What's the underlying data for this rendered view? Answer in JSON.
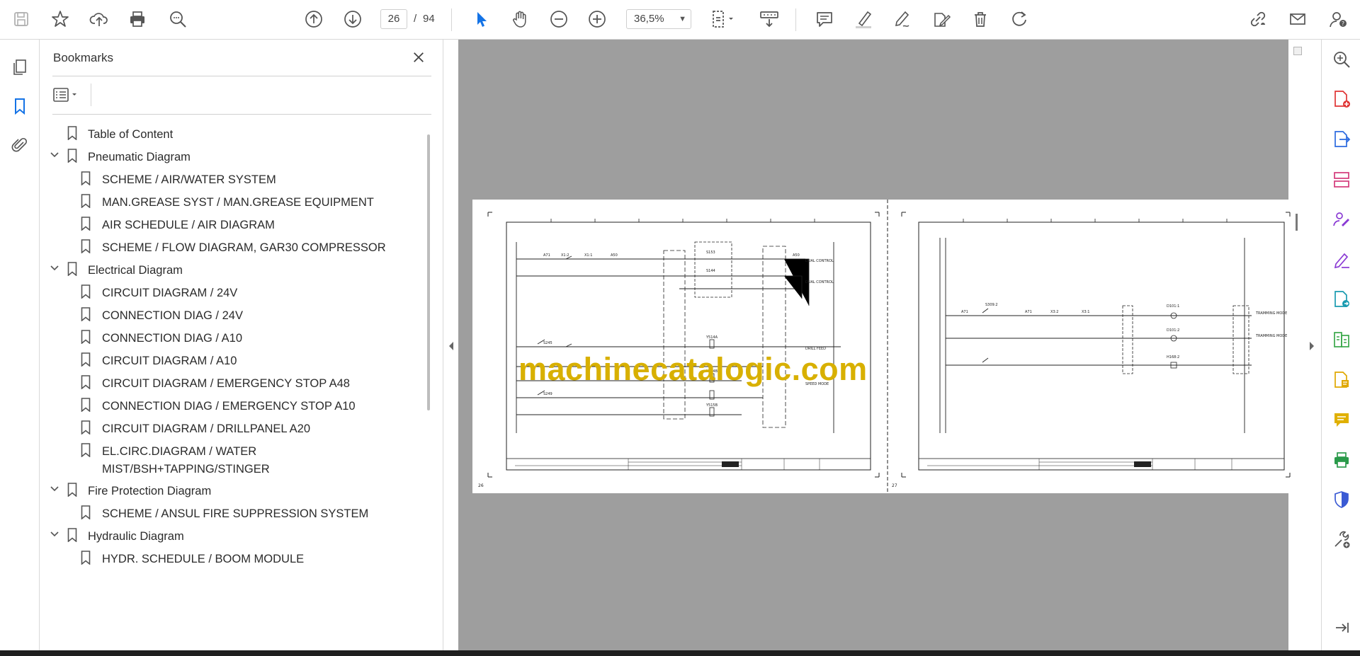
{
  "toolbar": {
    "current_page": "26",
    "page_separator": "/",
    "total_pages": "94",
    "zoom": "36,5%"
  },
  "bookmarks": {
    "title": "Bookmarks",
    "items": [
      {
        "label": "Table of Content"
      },
      {
        "label": "Pneumatic Diagram"
      },
      {
        "label": "SCHEME / AIR/WATER SYSTEM"
      },
      {
        "label": "MAN.GREASE SYST / MAN.GREASE EQUIPMENT"
      },
      {
        "label": "AIR SCHEDULE / AIR DIAGRAM"
      },
      {
        "label": "SCHEME / FLOW DIAGRAM, GAR30 COMPRESSOR"
      },
      {
        "label": "Electrical Diagram"
      },
      {
        "label": "CIRCUIT DIAGRAM / 24V"
      },
      {
        "label": "CONNECTION DIAG / 24V"
      },
      {
        "label": "CONNECTION DIAG / A10"
      },
      {
        "label": "CIRCUIT DIAGRAM / A10"
      },
      {
        "label": "CIRCUIT DIAGRAM / EMERGENCY STOP A48"
      },
      {
        "label": "CONNECTION DIAG / EMERGENCY STOP A10"
      },
      {
        "label": "CIRCUIT DIAGRAM / DRILLPANEL A20"
      },
      {
        "label": "EL.CIRC.DIAGRAM / WATER",
        "label2": "MIST/BSH+TAPPING/STINGER"
      },
      {
        "label": "Fire Protection Diagram"
      },
      {
        "label": "SCHEME / ANSUL FIRE SUPPRESSION SYSTEM"
      },
      {
        "label": "Hydraulic Diagram"
      },
      {
        "label": "HYDR. SCHEDULE / BOOM MODULE"
      }
    ]
  },
  "document": {
    "watermark": "machinecatalogic.com",
    "left_page_number": "26",
    "right_page_number": "27"
  },
  "colors": {
    "accent_blue": "#1473e6",
    "watermark": "#d8b000",
    "doc_background": "#9e9e9e"
  }
}
